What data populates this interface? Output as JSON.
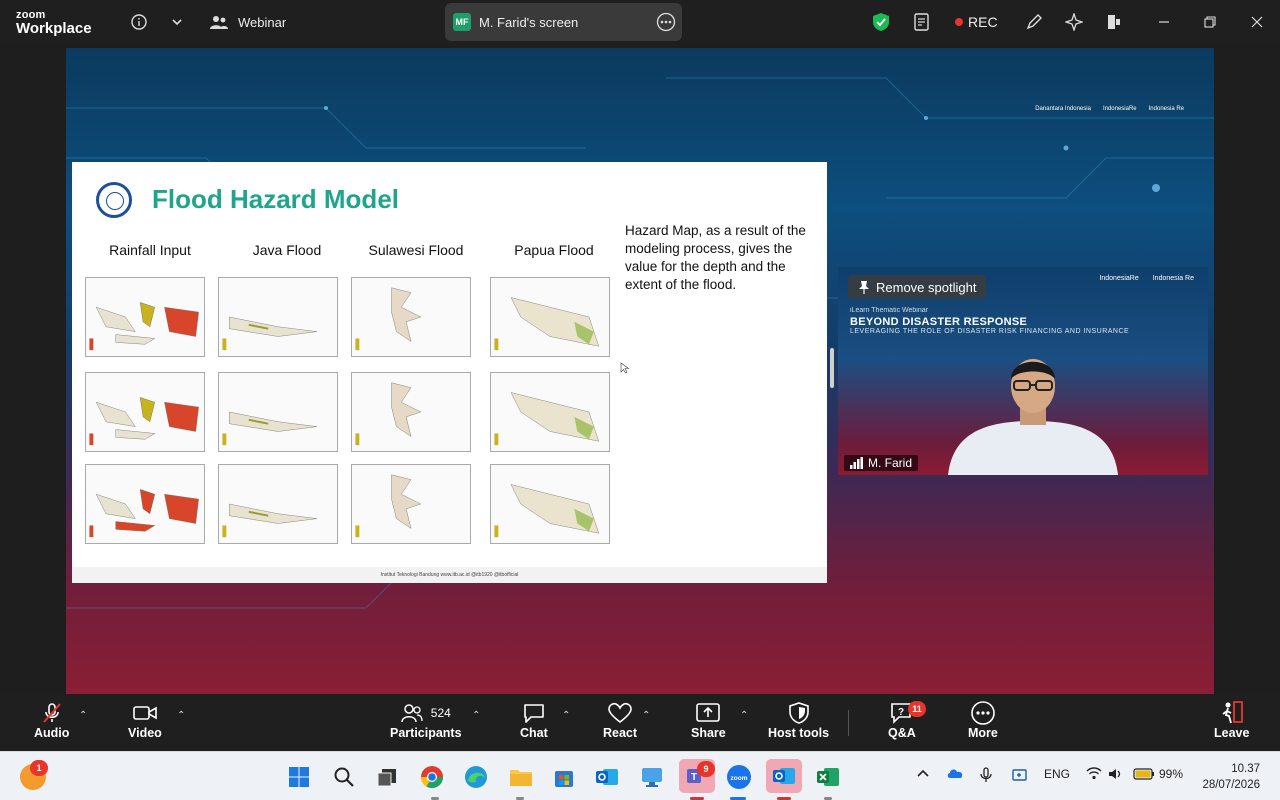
{
  "app": {
    "logo_line1": "zoom",
    "logo_line2": "Workplace",
    "meeting_name": "Webinar"
  },
  "topbar": {
    "screen_badge": "MF",
    "screen_label": "M. Farid's screen",
    "rec_label": "REC"
  },
  "slide": {
    "title": "Flood Hazard Model",
    "columns": [
      "Rainfall Input",
      "Java Flood",
      "Sulawesi Flood",
      "Papua Flood"
    ],
    "description": "Hazard Map, as a result of the modeling process, gives the value for the depth and the extent of the flood.",
    "footer": "Institut Teknologi Bandung   www.itb.ac.id   @itb1920   @itbofficial"
  },
  "share_header_logos": [
    "Danantara Indonesia",
    "IndonesiaRe",
    "Indonesia Re"
  ],
  "spotlight": {
    "remove_label": "Remove spotlight",
    "webinar_kicker": "iLearn Thematic Webinar",
    "webinar_title": "BEYOND DISASTER RESPONSE",
    "webinar_subtitle": "LEVERAGING THE ROLE OF DISASTER RISK FINANCING AND INSURANCE",
    "logos": [
      "IndonesiaRe",
      "Indonesia Re"
    ],
    "participant_name": "M. Farid"
  },
  "toolbar": {
    "audio": "Audio",
    "video": "Video",
    "participants": "Participants",
    "participants_count": "524",
    "chat": "Chat",
    "react": "React",
    "share": "Share",
    "host_tools": "Host tools",
    "qa": "Q&A",
    "qa_badge": "11",
    "more": "More",
    "leave": "Leave"
  },
  "taskbar": {
    "notification_badge": "1",
    "teams_badge": "9",
    "language": "ENG",
    "battery": "99%",
    "time": "10.37",
    "date": "28/07/2026"
  },
  "colors": {
    "slide_title": "#1fa58b",
    "rec_dot": "#e8352b",
    "shield": "#1db954",
    "leave": "#e8352b"
  }
}
